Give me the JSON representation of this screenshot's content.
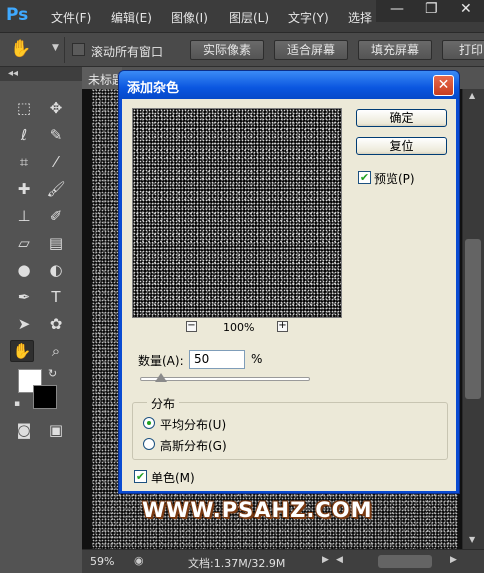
{
  "app": {
    "logo": "Ps"
  },
  "menu": [
    "文件(F)",
    "编辑(E)",
    "图像(I)",
    "图层(L)",
    "文字(Y)",
    "选择"
  ],
  "window_controls": [
    "minimize-icon",
    "restore-icon",
    "close-icon"
  ],
  "options_bar": {
    "tool_icon": "hand-icon",
    "scroll_all_label": "滚动所有窗口",
    "scroll_all_checked": false,
    "buttons": [
      "实际像素",
      "适合屏幕",
      "填充屏幕",
      "打印"
    ]
  },
  "document": {
    "tab_title": "未标题"
  },
  "status": {
    "zoom": "59%",
    "doc_info": "文档:1.37M/32.9M"
  },
  "watermark": "WWW.PSAHZ.COM",
  "dialog": {
    "title": "添加杂色",
    "ok_label": "确定",
    "reset_label": "复位",
    "preview_label": "预览(P)",
    "preview_checked": true,
    "zoom_level": "100%",
    "zoom_out": "−",
    "zoom_in": "+",
    "amount_label": "数量(A):",
    "amount_value": "50",
    "amount_unit": "%",
    "amount_fraction": 0.125,
    "distribution_label": "分布",
    "distribution_options": [
      {
        "label": "平均分布(U)",
        "checked": true
      },
      {
        "label": "高斯分布(G)",
        "checked": false
      }
    ],
    "monochrome_label": "单色(M)",
    "monochrome_checked": true
  },
  "colors": {
    "dialog_frame": "#0a4bd2",
    "dialog_body": "#ece9d8",
    "foreground": "#ffffff",
    "background": "#000000",
    "ps_blue": "#3fa9ff"
  }
}
